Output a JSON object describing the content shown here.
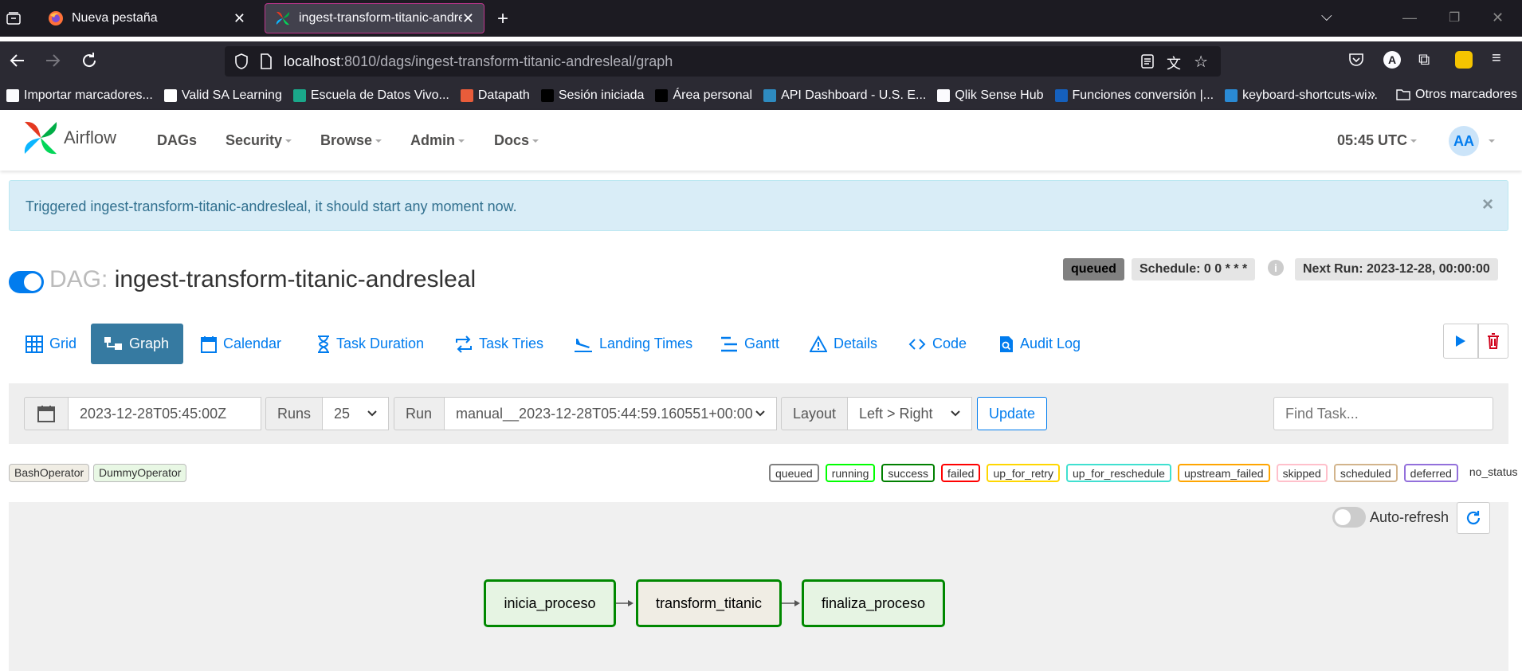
{
  "browser": {
    "tabs": [
      {
        "label": "Nueva pestaña",
        "icon": "firefox-icon"
      },
      {
        "label": "ingest-transform-titanic-andresleal",
        "icon": "airflow-pinwheel-icon"
      }
    ],
    "url_host": "localhost",
    "url_rest": ":8010/dags/ingest-transform-titanic-andresleal/graph",
    "account_initial": "A",
    "bookmarks": [
      {
        "label": "Importar marcadores...",
        "color": "#fbfbfe"
      },
      {
        "label": "Valid SA Learning",
        "color": "#ffffff"
      },
      {
        "label": "Escuela de Datos Vivo...",
        "color": "#1aa88a"
      },
      {
        "label": "Datapath",
        "color": "#e85c3a"
      },
      {
        "label": "Sesión iniciada",
        "color": "#000000"
      },
      {
        "label": "Área personal",
        "color": "#000000"
      },
      {
        "label": "API Dashboard - U.S. E...",
        "color": "#2e8bc0"
      },
      {
        "label": "Qlik Sense Hub",
        "color": "#fbfbfe"
      },
      {
        "label": "Funciones conversión |...",
        "color": "#1560bd"
      },
      {
        "label": "keyboard-shortcuts-wi...",
        "color": "#2a8ad4"
      }
    ],
    "other_bookmarks": "Otros marcadores"
  },
  "navbar": {
    "brand": "Airflow",
    "links": [
      "DAGs",
      "Security",
      "Browse",
      "Admin",
      "Docs"
    ],
    "time": "05:45 UTC",
    "avatar": "AA"
  },
  "alert": {
    "text": "Triggered ingest-transform-titanic-andresleal, it should start any moment now.",
    "close": "×"
  },
  "dag": {
    "prefix": "DAG:",
    "name": "ingest-transform-titanic-andresleal",
    "status": "queued",
    "schedule": "Schedule: 0 0 * * *",
    "next_run": "Next Run: 2023-12-28, 00:00:00"
  },
  "views": [
    "Grid",
    "Graph",
    "Calendar",
    "Task Duration",
    "Task Tries",
    "Landing Times",
    "Gantt",
    "Details",
    "Code",
    "Audit Log"
  ],
  "filters": {
    "date": "2023-12-28T05:45:00Z",
    "runs_label": "Runs",
    "runs_value": "25",
    "run_label": "Run",
    "run_value": "manual__2023-12-28T05:44:59.160551+00:00",
    "layout_label": "Layout",
    "layout_value": "Left > Right",
    "update": "Update",
    "find_placeholder": "Find Task..."
  },
  "operators": [
    {
      "label": "BashOperator",
      "color": "#f0ede4"
    },
    {
      "label": "DummyOperator",
      "color": "#e8f7e4"
    }
  ],
  "states": [
    {
      "label": "queued",
      "color": "#808080"
    },
    {
      "label": "running",
      "color": "#00ff00"
    },
    {
      "label": "success",
      "color": "#008000"
    },
    {
      "label": "failed",
      "color": "#ff0000"
    },
    {
      "label": "up_for_retry",
      "color": "#ffd700"
    },
    {
      "label": "up_for_reschedule",
      "color": "#40e0d0"
    },
    {
      "label": "upstream_failed",
      "color": "#ffa500"
    },
    {
      "label": "skipped",
      "color": "#ffc0cb"
    },
    {
      "label": "scheduled",
      "color": "#d2b48c"
    },
    {
      "label": "deferred",
      "color": "#9370db"
    },
    {
      "label": "no_status",
      "color": ""
    }
  ],
  "graph": {
    "autorefresh": "Auto-refresh",
    "nodes": [
      {
        "label": "inicia_proceso",
        "fill": "#e8f7e4"
      },
      {
        "label": "transform_titanic",
        "fill": "#f0ede4"
      },
      {
        "label": "finaliza_proceso",
        "fill": "#e8f7e4"
      }
    ]
  }
}
